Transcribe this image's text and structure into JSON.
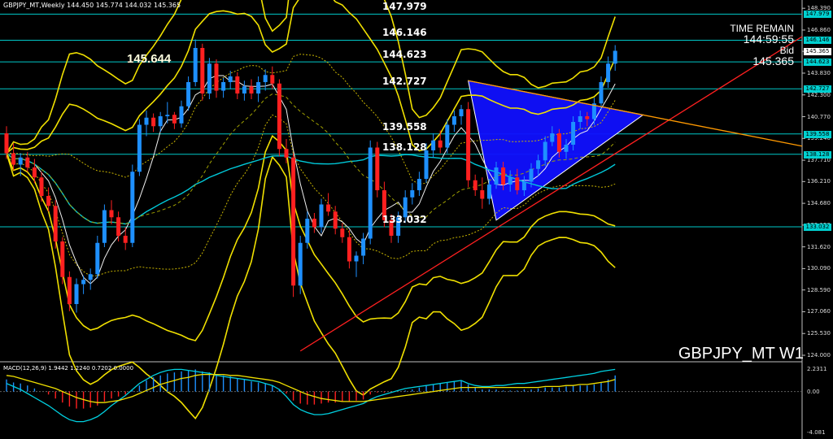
{
  "header": {
    "chart_info": "GBPJPY_MT,Weekly 144.450 145.774 144.032 145.365"
  },
  "symbol_label": "GBPJPY_MT W1",
  "time_remain": {
    "label": "TIME REMAIN",
    "value": "144:59:55",
    "bid_label": "Bid",
    "bid_value": "145.365"
  },
  "highlight_price": "145.644",
  "macd_label": "MACD(12,26,9) 1.9442 1.2240 0.7202 0.0000",
  "colors": {
    "background": "#000000",
    "bull": "#1e90ff",
    "bear": "#ff2020",
    "level_line": "#00c8c8",
    "band": "#f0e000",
    "triangle": "#1010ff",
    "trend_red": "#ff2020",
    "trend_orange": "#ff9900"
  },
  "chart_data": [
    {
      "type": "candlestick",
      "title": "GBPJPY_MT W1",
      "ylim": [
        124.0,
        148.4
      ],
      "yticks": [
        "148.390",
        "146.860",
        "145.365",
        "143.830",
        "142.300",
        "140.770",
        "139.240",
        "137.710",
        "136.210",
        "134.680",
        "133.150",
        "131.620",
        "130.090",
        "128.590",
        "127.060",
        "125.530",
        "124.000"
      ],
      "levels": [
        "147.979",
        "146.146",
        "144.623",
        "142.727",
        "139.558",
        "138.128",
        "133.032"
      ],
      "candles": [
        {
          "o": 139.6,
          "h": 140.1,
          "l": 137.8,
          "c": 138.2
        },
        {
          "o": 138.2,
          "h": 138.9,
          "l": 137.0,
          "c": 137.4
        },
        {
          "o": 137.4,
          "h": 138.2,
          "l": 136.6,
          "c": 137.9
        },
        {
          "o": 137.9,
          "h": 138.3,
          "l": 136.9,
          "c": 137.2
        },
        {
          "o": 137.2,
          "h": 137.8,
          "l": 136.1,
          "c": 136.5
        },
        {
          "o": 136.5,
          "h": 136.9,
          "l": 134.8,
          "c": 135.2
        },
        {
          "o": 135.2,
          "h": 135.8,
          "l": 134.1,
          "c": 134.5
        },
        {
          "o": 134.5,
          "h": 134.9,
          "l": 131.5,
          "c": 132.0
        },
        {
          "o": 132.0,
          "h": 132.3,
          "l": 129.0,
          "c": 129.5
        },
        {
          "o": 129.5,
          "h": 129.9,
          "l": 127.1,
          "c": 127.6
        },
        {
          "o": 127.6,
          "h": 129.4,
          "l": 127.0,
          "c": 129.0
        },
        {
          "o": 129.0,
          "h": 129.6,
          "l": 128.3,
          "c": 129.3
        },
        {
          "o": 129.3,
          "h": 130.1,
          "l": 128.6,
          "c": 129.7
        },
        {
          "o": 129.7,
          "h": 132.4,
          "l": 129.4,
          "c": 131.9
        },
        {
          "o": 131.9,
          "h": 134.6,
          "l": 131.6,
          "c": 134.2
        },
        {
          "o": 134.2,
          "h": 134.9,
          "l": 133.2,
          "c": 133.7
        },
        {
          "o": 133.7,
          "h": 134.1,
          "l": 132.0,
          "c": 132.4
        },
        {
          "o": 132.4,
          "h": 133.0,
          "l": 131.4,
          "c": 131.9
        },
        {
          "o": 131.9,
          "h": 137.4,
          "l": 131.6,
          "c": 136.9
        },
        {
          "o": 136.9,
          "h": 140.6,
          "l": 136.6,
          "c": 140.2
        },
        {
          "o": 140.2,
          "h": 141.2,
          "l": 139.4,
          "c": 140.7
        },
        {
          "o": 140.7,
          "h": 141.0,
          "l": 139.7,
          "c": 140.1
        },
        {
          "o": 140.1,
          "h": 141.1,
          "l": 139.7,
          "c": 140.8
        },
        {
          "o": 140.8,
          "h": 141.8,
          "l": 140.3,
          "c": 140.9
        },
        {
          "o": 140.9,
          "h": 141.1,
          "l": 139.9,
          "c": 140.3
        },
        {
          "o": 140.3,
          "h": 141.9,
          "l": 140.0,
          "c": 141.5
        },
        {
          "o": 141.5,
          "h": 143.6,
          "l": 141.2,
          "c": 143.2
        },
        {
          "o": 143.2,
          "h": 146.2,
          "l": 142.9,
          "c": 145.6
        },
        {
          "o": 145.6,
          "h": 145.9,
          "l": 141.9,
          "c": 142.4
        },
        {
          "o": 142.4,
          "h": 144.9,
          "l": 142.0,
          "c": 144.5
        },
        {
          "o": 144.5,
          "h": 144.8,
          "l": 142.1,
          "c": 142.6
        },
        {
          "o": 142.6,
          "h": 143.5,
          "l": 142.1,
          "c": 143.2
        },
        {
          "o": 143.2,
          "h": 144.0,
          "l": 142.7,
          "c": 143.6
        },
        {
          "o": 143.6,
          "h": 143.9,
          "l": 142.0,
          "c": 142.4
        },
        {
          "o": 142.4,
          "h": 143.3,
          "l": 141.9,
          "c": 142.9
        },
        {
          "o": 142.9,
          "h": 143.4,
          "l": 142.0,
          "c": 142.4
        },
        {
          "o": 142.4,
          "h": 143.6,
          "l": 141.8,
          "c": 143.2
        },
        {
          "o": 143.2,
          "h": 144.1,
          "l": 142.6,
          "c": 143.7
        },
        {
          "o": 143.7,
          "h": 144.3,
          "l": 142.7,
          "c": 143.1
        },
        {
          "o": 143.1,
          "h": 143.4,
          "l": 138.0,
          "c": 138.5
        },
        {
          "o": 138.5,
          "h": 139.2,
          "l": 137.5,
          "c": 137.9
        },
        {
          "o": 137.9,
          "h": 138.2,
          "l": 128.1,
          "c": 128.9
        },
        {
          "o": 128.9,
          "h": 132.4,
          "l": 128.3,
          "c": 131.9
        },
        {
          "o": 131.9,
          "h": 134.1,
          "l": 131.5,
          "c": 133.6
        },
        {
          "o": 133.6,
          "h": 134.0,
          "l": 132.6,
          "c": 133.0
        },
        {
          "o": 133.0,
          "h": 135.0,
          "l": 132.6,
          "c": 134.6
        },
        {
          "o": 134.6,
          "h": 135.4,
          "l": 133.8,
          "c": 134.1
        },
        {
          "o": 134.1,
          "h": 134.5,
          "l": 132.5,
          "c": 132.9
        },
        {
          "o": 132.9,
          "h": 133.3,
          "l": 131.9,
          "c": 132.3
        },
        {
          "o": 132.3,
          "h": 132.8,
          "l": 130.1,
          "c": 130.6
        },
        {
          "o": 130.6,
          "h": 131.3,
          "l": 129.5,
          "c": 131.0
        },
        {
          "o": 131.0,
          "h": 132.6,
          "l": 130.4,
          "c": 132.2
        },
        {
          "o": 132.2,
          "h": 139.1,
          "l": 131.8,
          "c": 138.6
        },
        {
          "o": 138.6,
          "h": 139.0,
          "l": 135.1,
          "c": 135.6
        },
        {
          "o": 135.6,
          "h": 136.2,
          "l": 133.0,
          "c": 133.5
        },
        {
          "o": 133.5,
          "h": 133.9,
          "l": 131.9,
          "c": 132.4
        },
        {
          "o": 132.4,
          "h": 134.1,
          "l": 131.9,
          "c": 133.7
        },
        {
          "o": 133.7,
          "h": 135.6,
          "l": 133.3,
          "c": 135.1
        },
        {
          "o": 135.1,
          "h": 136.1,
          "l": 134.6,
          "c": 135.6
        },
        {
          "o": 135.6,
          "h": 136.9,
          "l": 135.2,
          "c": 136.4
        },
        {
          "o": 136.4,
          "h": 138.9,
          "l": 136.1,
          "c": 138.4
        },
        {
          "o": 138.4,
          "h": 139.6,
          "l": 137.9,
          "c": 139.1
        },
        {
          "o": 139.1,
          "h": 139.8,
          "l": 138.2,
          "c": 138.6
        },
        {
          "o": 138.6,
          "h": 140.6,
          "l": 138.2,
          "c": 140.2
        },
        {
          "o": 140.2,
          "h": 141.2,
          "l": 139.7,
          "c": 140.8
        },
        {
          "o": 140.8,
          "h": 141.6,
          "l": 140.2,
          "c": 141.3
        },
        {
          "o": 141.3,
          "h": 141.8,
          "l": 135.8,
          "c": 136.3
        },
        {
          "o": 136.3,
          "h": 136.7,
          "l": 135.2,
          "c": 135.6
        },
        {
          "o": 135.6,
          "h": 136.5,
          "l": 134.3,
          "c": 135.0
        },
        {
          "o": 135.0,
          "h": 136.4,
          "l": 134.6,
          "c": 136.0
        },
        {
          "o": 136.0,
          "h": 137.6,
          "l": 135.7,
          "c": 137.2
        },
        {
          "o": 137.2,
          "h": 137.6,
          "l": 135.6,
          "c": 136.0
        },
        {
          "o": 136.0,
          "h": 137.0,
          "l": 135.5,
          "c": 136.5
        },
        {
          "o": 136.5,
          "h": 137.1,
          "l": 135.3,
          "c": 135.6
        },
        {
          "o": 135.6,
          "h": 136.6,
          "l": 135.2,
          "c": 136.2
        },
        {
          "o": 136.2,
          "h": 137.5,
          "l": 135.8,
          "c": 137.1
        },
        {
          "o": 137.1,
          "h": 138.1,
          "l": 136.6,
          "c": 137.7
        },
        {
          "o": 137.7,
          "h": 139.4,
          "l": 137.3,
          "c": 139.0
        },
        {
          "o": 139.0,
          "h": 140.1,
          "l": 138.7,
          "c": 139.6
        },
        {
          "o": 139.6,
          "h": 139.9,
          "l": 137.9,
          "c": 138.3
        },
        {
          "o": 138.3,
          "h": 139.2,
          "l": 137.8,
          "c": 138.8
        },
        {
          "o": 138.8,
          "h": 140.8,
          "l": 138.4,
          "c": 140.4
        },
        {
          "o": 140.4,
          "h": 141.2,
          "l": 139.9,
          "c": 140.8
        },
        {
          "o": 140.8,
          "h": 141.1,
          "l": 140.1,
          "c": 140.6
        },
        {
          "o": 140.6,
          "h": 142.1,
          "l": 140.2,
          "c": 141.7
        },
        {
          "o": 141.7,
          "h": 143.6,
          "l": 141.3,
          "c": 143.2
        },
        {
          "o": 143.2,
          "h": 145.0,
          "l": 142.8,
          "c": 144.5
        },
        {
          "o": 144.5,
          "h": 145.8,
          "l": 144.0,
          "c": 145.4
        }
      ],
      "macd": {
        "ylim": [
          -4.081,
          2.2311
        ],
        "yticks": [
          "2.2311",
          "0.00",
          "-4.081"
        ],
        "histogram": [
          1.2,
          0.9,
          0.8,
          0.6,
          0.3,
          0.0,
          -0.3,
          -0.7,
          -1.1,
          -1.5,
          -1.7,
          -1.7,
          -1.6,
          -1.4,
          -1.0,
          -0.7,
          -0.5,
          -0.3,
          0.1,
          0.6,
          1.1,
          1.4,
          1.6,
          1.8,
          1.9,
          2.0,
          2.1,
          2.2,
          2.0,
          1.9,
          1.7,
          1.6,
          1.5,
          1.3,
          1.2,
          1.0,
          0.9,
          0.8,
          0.6,
          0.2,
          -0.2,
          -0.9,
          -1.2,
          -1.3,
          -1.3,
          -1.2,
          -1.1,
          -1.1,
          -1.0,
          -1.0,
          -0.9,
          -0.8,
          -0.3,
          -0.1,
          -0.1,
          -0.1,
          0.0,
          0.1,
          0.2,
          0.4,
          0.6,
          0.7,
          0.8,
          0.9,
          1.0,
          1.1,
          0.7,
          0.4,
          0.2,
          0.2,
          0.2,
          0.1,
          0.1,
          0.1,
          0.2,
          0.2,
          0.3,
          0.4,
          0.4,
          0.4,
          0.5,
          0.6,
          0.6,
          0.6,
          0.7,
          0.9,
          1.2,
          1.6
        ],
        "signal": [
          1.6,
          1.5,
          1.3,
          1.1,
          0.9,
          0.7,
          0.5,
          0.3,
          0.0,
          -0.3,
          -0.6,
          -0.8,
          -1.0,
          -1.1,
          -1.1,
          -1.0,
          -0.9,
          -0.7,
          -0.5,
          -0.2,
          0.1,
          0.4,
          0.7,
          0.9,
          1.1,
          1.3,
          1.4,
          1.6,
          1.7,
          1.7,
          1.7,
          1.7,
          1.6,
          1.6,
          1.5,
          1.4,
          1.3,
          1.2,
          1.1,
          0.9,
          0.6,
          0.3,
          0.0,
          -0.3,
          -0.5,
          -0.7,
          -0.8,
          -0.9,
          -1.0,
          -1.0,
          -1.0,
          -1.0,
          -0.9,
          -0.8,
          -0.7,
          -0.6,
          -0.5,
          -0.4,
          -0.3,
          -0.2,
          -0.1,
          0.0,
          0.1,
          0.2,
          0.3,
          0.4,
          0.4,
          0.4,
          0.4,
          0.4,
          0.4,
          0.4,
          0.4,
          0.4,
          0.4,
          0.4,
          0.4,
          0.5,
          0.5,
          0.5,
          0.6,
          0.6,
          0.7,
          0.7,
          0.8,
          0.9,
          1.0,
          1.2
        ],
        "macd_line": [
          0.8,
          0.5,
          0.2,
          -0.2,
          -0.6,
          -1.0,
          -1.4,
          -1.9,
          -2.4,
          -2.8,
          -3.0,
          -3.0,
          -2.8,
          -2.5,
          -2.0,
          -1.4,
          -0.9,
          -0.4,
          0.2,
          0.8,
          1.2,
          1.6,
          1.9,
          2.1,
          2.2,
          2.2,
          2.1,
          2.0,
          1.9,
          1.8,
          1.6,
          1.5,
          1.4,
          1.3,
          1.2,
          1.1,
          1.0,
          0.8,
          0.6,
          0.2,
          -0.5,
          -1.3,
          -1.8,
          -2.1,
          -2.3,
          -2.3,
          -2.2,
          -2.0,
          -1.8,
          -1.6,
          -1.4,
          -1.2,
          -0.8,
          -0.5,
          -0.3,
          -0.1,
          0.1,
          0.3,
          0.4,
          0.5,
          0.6,
          0.7,
          0.8,
          0.9,
          1.0,
          1.1,
          0.8,
          0.6,
          0.5,
          0.5,
          0.6,
          0.6,
          0.7,
          0.8,
          0.8,
          0.9,
          1.0,
          1.1,
          1.2,
          1.3,
          1.4,
          1.5,
          1.6,
          1.7,
          1.8,
          2.0,
          2.1,
          2.2
        ]
      }
    }
  ]
}
